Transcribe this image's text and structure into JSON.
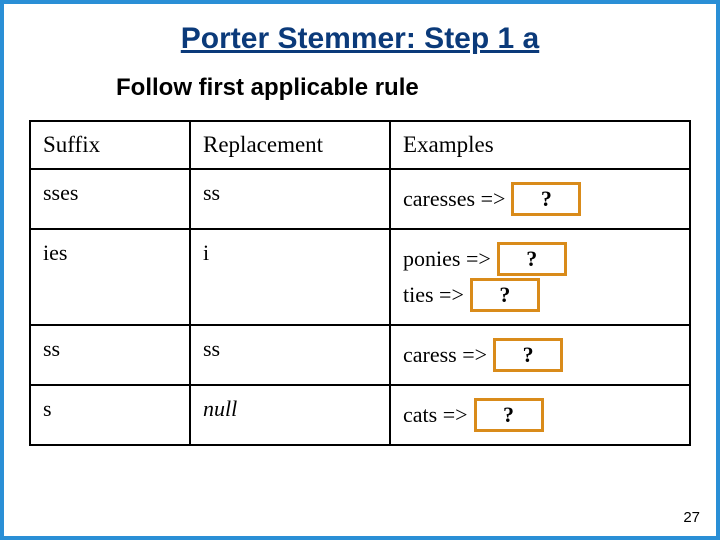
{
  "title": "Porter Stemmer: Step 1 a",
  "subtitle": "Follow first applicable rule",
  "headers": {
    "suffix": "Suffix",
    "replacement": "Replacement",
    "examples": "Examples"
  },
  "rows": [
    {
      "suffix": "sses",
      "replacement": "ss",
      "examples": [
        {
          "text": "caresses =>",
          "mask": "?"
        }
      ]
    },
    {
      "suffix": "ies",
      "replacement": "i",
      "examples": [
        {
          "text": "ponies =>",
          "mask": "?"
        },
        {
          "text": "ties =>",
          "mask": "?"
        }
      ]
    },
    {
      "suffix": "ss",
      "replacement": "ss",
      "examples": [
        {
          "text": "caress =>",
          "mask": "?"
        }
      ]
    },
    {
      "suffix": "s",
      "replacement": "null",
      "replacement_italic": true,
      "examples": [
        {
          "text": "cats =>",
          "mask": "?"
        }
      ]
    }
  ],
  "page_number": "27",
  "chart_data": {
    "type": "table",
    "title": "Porter Stemmer: Step 1 a — Follow first applicable rule",
    "columns": [
      "Suffix",
      "Replacement",
      "Examples"
    ],
    "rows": [
      [
        "sses",
        "ss",
        "caresses => ?"
      ],
      [
        "ies",
        "i",
        "ponies => ? ; ties => ?"
      ],
      [
        "ss",
        "ss",
        "caress => ?"
      ],
      [
        "s",
        "null",
        "cats => ?"
      ]
    ]
  }
}
